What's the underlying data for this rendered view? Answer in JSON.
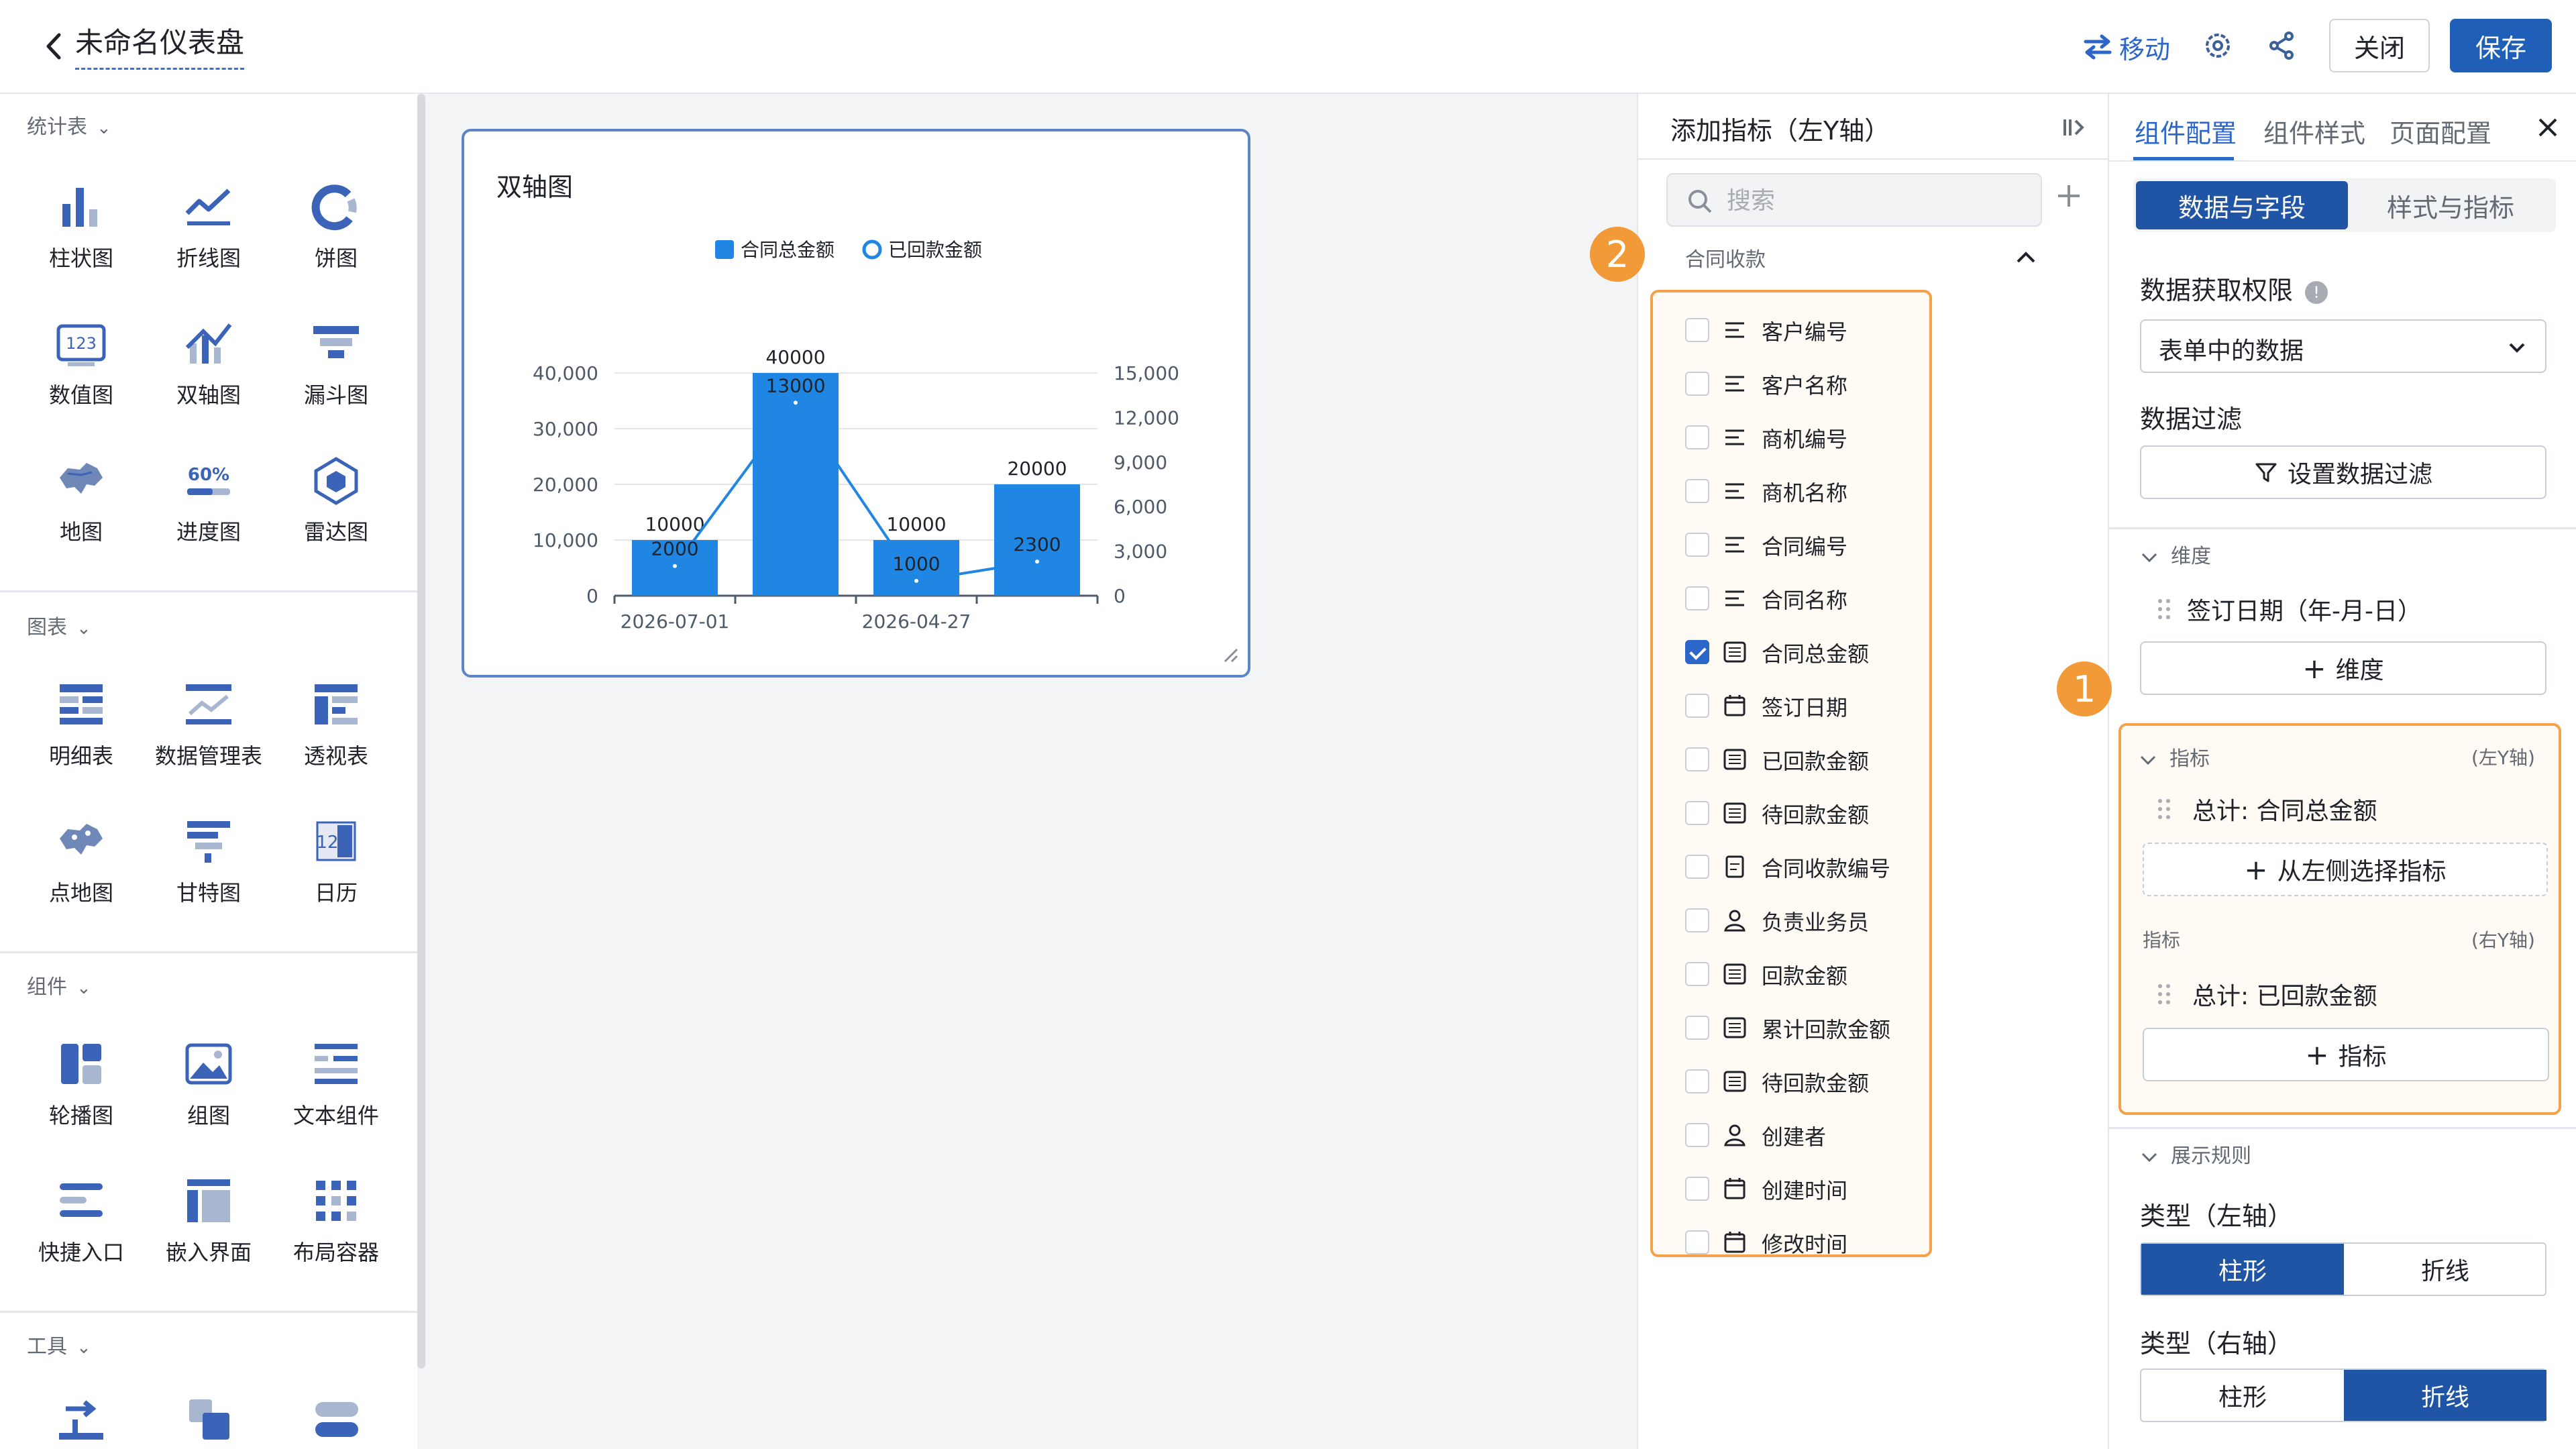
{
  "header": {
    "title": "未命名仪表盘",
    "move_label": "移动",
    "close_label": "关闭",
    "save_label": "保存"
  },
  "left": {
    "sections": [
      {
        "title": "统计表",
        "items": [
          {
            "label": "柱状图",
            "icon": "bar-chart-icon"
          },
          {
            "label": "折线图",
            "icon": "line-chart-icon"
          },
          {
            "label": "饼图",
            "icon": "pie-chart-icon"
          },
          {
            "label": "数值图",
            "icon": "number-card-icon"
          },
          {
            "label": "双轴图",
            "icon": "dual-axis-icon"
          },
          {
            "label": "漏斗图",
            "icon": "funnel-icon"
          },
          {
            "label": "地图",
            "icon": "map-icon"
          },
          {
            "label": "进度图",
            "icon": "progress-icon"
          },
          {
            "label": "雷达图",
            "icon": "radar-icon"
          }
        ]
      },
      {
        "title": "图表",
        "items": [
          {
            "label": "明细表",
            "icon": "detail-table-icon"
          },
          {
            "label": "数据管理表",
            "icon": "data-table-icon"
          },
          {
            "label": "透视表",
            "icon": "pivot-table-icon"
          },
          {
            "label": "点地图",
            "icon": "point-map-icon"
          },
          {
            "label": "甘特图",
            "icon": "gantt-icon"
          },
          {
            "label": "日历",
            "icon": "calendar-icon"
          }
        ]
      },
      {
        "title": "组件",
        "items": [
          {
            "label": "轮播图",
            "icon": "carousel-icon"
          },
          {
            "label": "组图",
            "icon": "image-group-icon"
          },
          {
            "label": "文本组件",
            "icon": "text-icon"
          },
          {
            "label": "快捷入口",
            "icon": "shortcut-icon"
          },
          {
            "label": "嵌入界面",
            "icon": "embed-icon"
          },
          {
            "label": "布局容器",
            "icon": "layout-icon"
          }
        ]
      },
      {
        "title": "工具",
        "items": []
      }
    ],
    "progress_label": "60%",
    "number_label": "123",
    "calendar_label": "12"
  },
  "card": {
    "title": "双轴图"
  },
  "chart_data": {
    "type": "bar",
    "categories": [
      "2026-07-01",
      "",
      "2026-04-27",
      ""
    ],
    "series": [
      {
        "name": "合同总金额",
        "type": "bar",
        "axis": "left",
        "values": [
          10000,
          40000,
          10000,
          20000
        ]
      },
      {
        "name": "已回款金额",
        "type": "line",
        "axis": "right",
        "values": [
          2000,
          13000,
          1000,
          2300
        ]
      }
    ],
    "left_axis": {
      "ticks": [
        "0",
        "10,000",
        "20,000",
        "30,000",
        "40,000"
      ],
      "range": [
        0,
        40000
      ]
    },
    "right_axis": {
      "ticks": [
        "0",
        "3,000",
        "6,000",
        "9,000",
        "12,000",
        "15,000"
      ],
      "range": [
        0,
        15000
      ]
    },
    "bar_labels": [
      "10000",
      "40000",
      "10000",
      "20000"
    ],
    "line_labels": [
      "2000",
      "13000",
      "1000",
      "2300"
    ],
    "bar_color": "#1f86e3",
    "legend_position": "top"
  },
  "mid": {
    "title": "添加指标（左Y轴）",
    "search_placeholder": "搜索",
    "group_label": "合同收款",
    "fields": [
      {
        "label": "客户编号",
        "icon": "text-field-icon",
        "checked": false
      },
      {
        "label": "客户名称",
        "icon": "text-field-icon",
        "checked": false
      },
      {
        "label": "商机编号",
        "icon": "text-field-icon",
        "checked": false
      },
      {
        "label": "商机名称",
        "icon": "text-field-icon",
        "checked": false
      },
      {
        "label": "合同编号",
        "icon": "text-field-icon",
        "checked": false
      },
      {
        "label": "合同名称",
        "icon": "text-field-icon",
        "checked": false
      },
      {
        "label": "合同总金额",
        "icon": "amount-field-icon",
        "checked": true
      },
      {
        "label": "签订日期",
        "icon": "date-field-icon",
        "checked": false
      },
      {
        "label": "已回款金额",
        "icon": "amount-field-icon",
        "checked": false
      },
      {
        "label": "待回款金额",
        "icon": "amount-field-icon",
        "checked": false
      },
      {
        "label": "合同收款编号",
        "icon": "serial-field-icon",
        "checked": false
      },
      {
        "label": "负责业务员",
        "icon": "user-field-icon",
        "checked": false
      },
      {
        "label": "回款金额",
        "icon": "amount-field-icon",
        "checked": false
      },
      {
        "label": "累计回款金额",
        "icon": "amount-field-icon",
        "checked": false
      },
      {
        "label": "待回款金额",
        "icon": "amount-field-icon",
        "checked": false
      },
      {
        "label": "创建者",
        "icon": "user-field-icon",
        "checked": false
      },
      {
        "label": "创建时间",
        "icon": "date-field-icon",
        "checked": false
      },
      {
        "label": "修改时间",
        "icon": "date-field-icon",
        "checked": false
      }
    ]
  },
  "right": {
    "tabs": [
      "组件配置",
      "组件样式",
      "页面配置"
    ],
    "seg_data": "数据与字段",
    "seg_style": "样式与指标",
    "permission_label": "数据获取权限",
    "permission_value": "表单中的数据",
    "filter_label": "数据过滤",
    "filter_btn": "设置数据过滤",
    "dimension_section": "维度",
    "dimension_item": "签订日期（年-月-日）",
    "add_dimension": "维度",
    "metric_section": "指标",
    "metric_left_tag": "(左Y轴)",
    "metric_left_item": "总计:  合同总金额",
    "add_from_left": "从左侧选择指标",
    "metric_right_label": "指标",
    "metric_right_tag": "(右Y轴)",
    "metric_right_item": "总计:  已回款金额",
    "add_metric": "指标",
    "display_section": "展示规则",
    "type_left_label": "类型（左轴）",
    "type_right_label": "类型（右轴）",
    "opt_bar": "柱形",
    "opt_line": "折线"
  },
  "badges": [
    "1",
    "2"
  ],
  "colors": {
    "accent": "#2b66c8",
    "primary_btn": "#1f5fb8",
    "highlight": "#f5a04a",
    "badge": "#f29a38"
  }
}
